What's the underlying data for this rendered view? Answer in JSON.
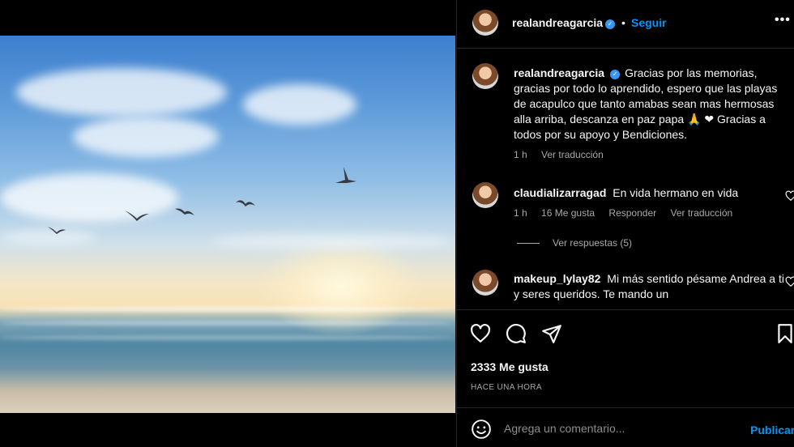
{
  "post": {
    "image_alt_icon": "beach-sunset-photo"
  },
  "header": {
    "username": "realandreagarcia",
    "separator": "•",
    "follow_label": "Seguir",
    "more_label": "•••"
  },
  "caption": {
    "username": "realandreagarcia",
    "text": "Gracias por las memorias, gracias por todo lo aprendido, espero que las playas de acapulco que tanto amabas sean mas hermosas alla arriba, descanza en paz papa 🙏 ❤ Gracias a todos por su apoyo y Bendiciones.",
    "time": "1 h",
    "translate": "Ver traducción"
  },
  "comments": [
    {
      "username": "claudializarragad",
      "text": "En vida hermano en vida",
      "time": "1 h",
      "likes": "16 Me gusta",
      "reply": "Responder",
      "translate": "Ver traducción",
      "view_replies": "Ver respuestas (5)"
    },
    {
      "username": "makeup_lylay82",
      "text": "Mi más sentido pésame Andrea a ti y seres queridos. Te mando un"
    }
  ],
  "stats": {
    "likes": "2333 Me gusta",
    "posted": "HACE UNA HORA"
  },
  "composer": {
    "placeholder": "Agrega un comentario...",
    "publish_label": "Publicar"
  },
  "colors": {
    "background": "#000000",
    "accent": "#0095f6",
    "secondary_text": "#a8a8a8",
    "divider": "#262626"
  }
}
